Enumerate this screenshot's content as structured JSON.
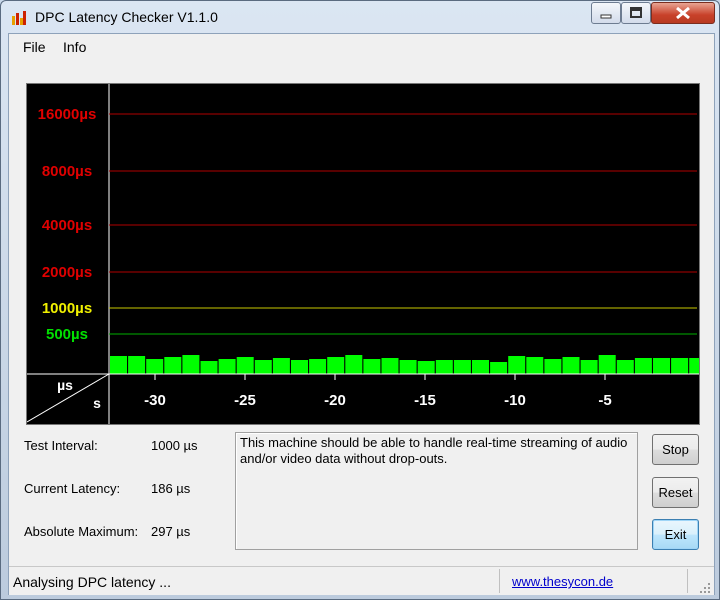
{
  "window": {
    "title": "DPC Latency Checker V1.1.0",
    "icon": "bar-chart-app-icon"
  },
  "menu": {
    "items": [
      "File",
      "Info"
    ]
  },
  "plot": {
    "y_labels": [
      {
        "text": "16000µs",
        "color": "#e00000"
      },
      {
        "text": "8000µs",
        "color": "#e00000"
      },
      {
        "text": "4000µs",
        "color": "#e00000"
      },
      {
        "text": "2000µs",
        "color": "#e00000"
      },
      {
        "text": "1000µs",
        "color": "#f0f000"
      },
      {
        "text": "500µs",
        "color": "#00e000"
      }
    ],
    "corner_top": "µs",
    "corner_bottom": "s",
    "x_labels": [
      "-30",
      "-25",
      "-20",
      "-15",
      "-10",
      "-5"
    ],
    "bar_color": "#00ff00",
    "bar_relative_heights": [
      0.9,
      0.9,
      0.75,
      0.85,
      0.95,
      0.65,
      0.75,
      0.85,
      0.7,
      0.8,
      0.7,
      0.75,
      0.85,
      0.95,
      0.75,
      0.8,
      0.7,
      0.65,
      0.7,
      0.7,
      0.7,
      0.6,
      0.9,
      0.85,
      0.75,
      0.85,
      0.7,
      0.95,
      0.7,
      0.8,
      0.8,
      0.8,
      0.8,
      0.8,
      0.85
    ]
  },
  "info": {
    "test_interval_label": "Test Interval:",
    "test_interval_value": "1000 µs",
    "current_latency_label": "Current Latency:",
    "current_latency_value": "186 µs",
    "absolute_max_label": "Absolute Maximum:",
    "absolute_max_value": "297 µs"
  },
  "message": "This machine should be able to handle real-time streaming of audio and/or video data without drop-outs.",
  "buttons": {
    "stop": "Stop",
    "reset": "Reset",
    "exit": "Exit"
  },
  "status": {
    "text": "Analysing DPC latency ...",
    "link": "www.thesycon.de"
  }
}
